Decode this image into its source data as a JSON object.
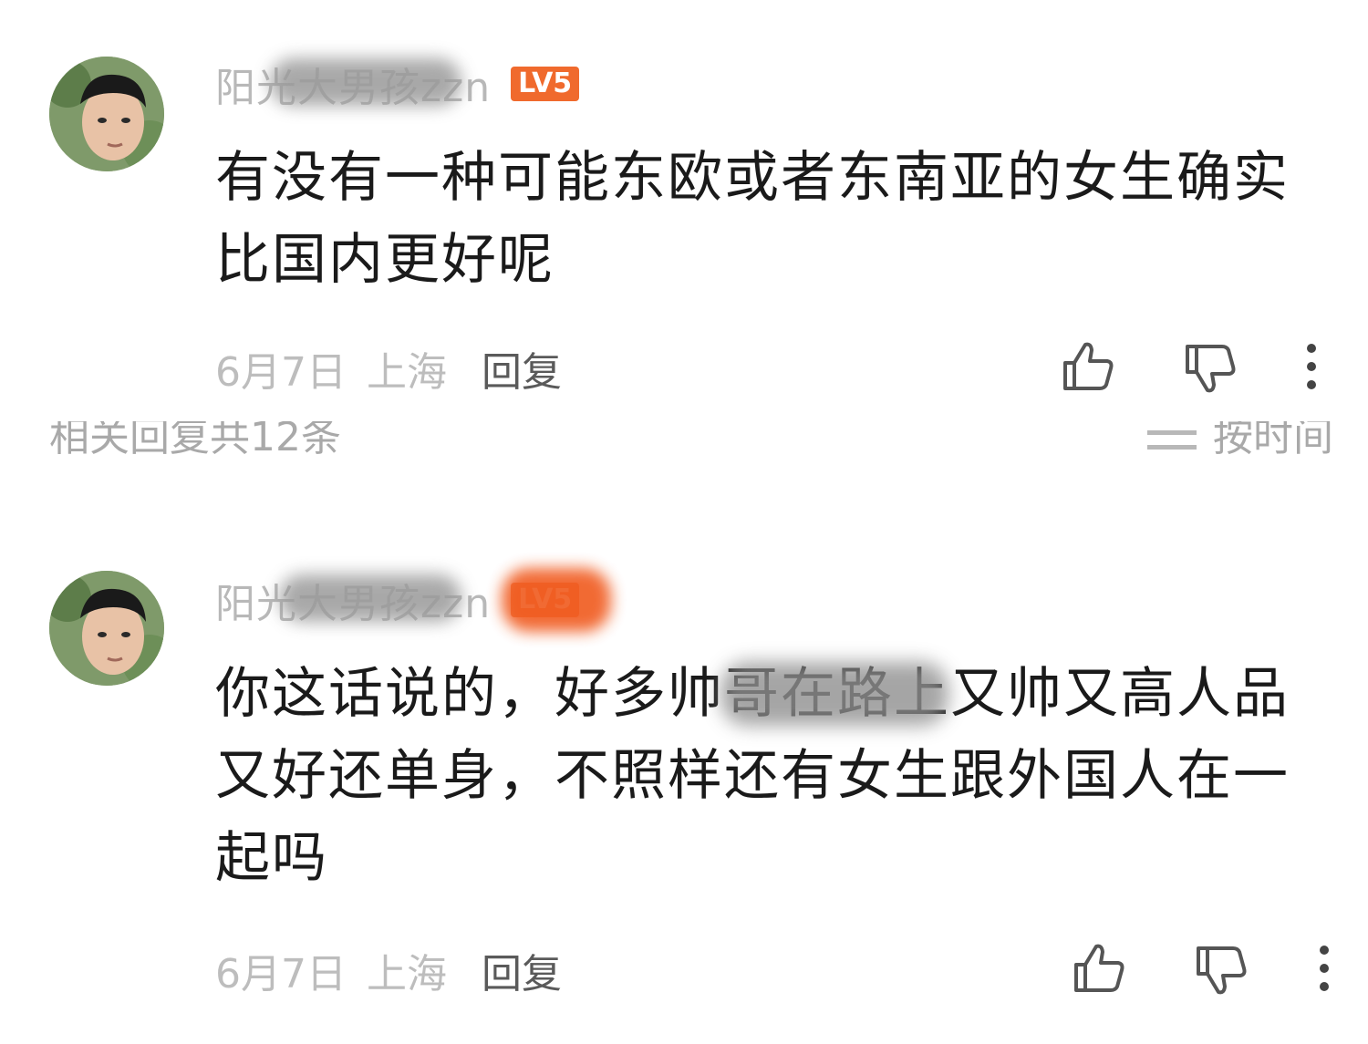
{
  "section": {
    "replies_count_label": "相关回复共12条",
    "sort_label": "按时间"
  },
  "comments": [
    {
      "username": "阳光大男孩zzn",
      "level_badge": "LV5",
      "text": "有没有一种可能东欧或者东南亚的女生确实比国内更好呢",
      "date": "6月7日",
      "location": "上海",
      "reply_label": "回复"
    },
    {
      "username": "阳光大男孩zzn",
      "level_badge": "LV5",
      "text": "你这话说的，好多帅哥在路上又帅又高人品又好还单身，不照样还有女生跟外国人在一起吗",
      "date": "6月7日",
      "location": "上海",
      "reply_label": "回复"
    }
  ],
  "icons": {
    "like": "thumbs-up-icon",
    "dislike": "thumbs-down-icon",
    "more": "more-vertical-icon"
  },
  "colors": {
    "badge": "#f06a2d",
    "meta_text": "#bdbdbd",
    "reply_text": "#5a5a5a",
    "body_text": "#1a1a1a"
  }
}
